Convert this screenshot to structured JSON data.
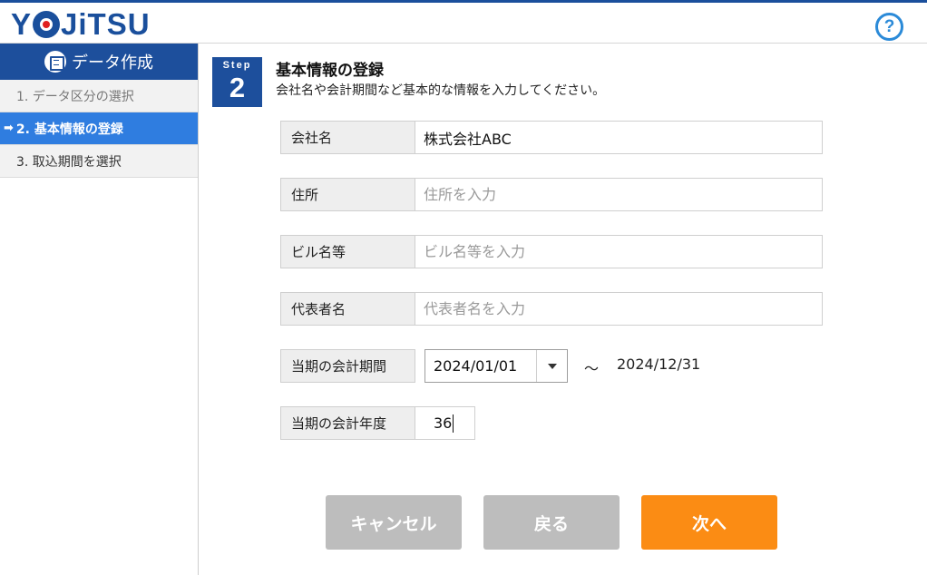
{
  "header": {
    "logo_text": "YOJiTSU",
    "help_label": "?"
  },
  "sidebar": {
    "title": "データ作成",
    "items": [
      {
        "label": "1. データ区分の選択",
        "state": "done"
      },
      {
        "label": "2. 基本情報の登録",
        "state": "active"
      },
      {
        "label": "3. 取込期間を選択",
        "state": "pending"
      }
    ]
  },
  "step": {
    "small_label": "Step",
    "number": "2",
    "title": "基本情報の登録",
    "subtitle": "会社名や会計期間など基本的な情報を入力してください。"
  },
  "form": {
    "company": {
      "label": "会社名",
      "value": "株式会社ABC",
      "placeholder": ""
    },
    "address": {
      "label": "住所",
      "value": "",
      "placeholder": "住所を入力"
    },
    "building": {
      "label": "ビル名等",
      "value": "",
      "placeholder": "ビル名等を入力"
    },
    "representative": {
      "label": "代表者名",
      "value": "",
      "placeholder": "代表者名を入力"
    },
    "period": {
      "label": "当期の会計期間",
      "start": "2024/01/01",
      "separator": "～",
      "end": "2024/12/31"
    },
    "fiscal_year": {
      "label": "当期の会計年度",
      "value": "36"
    }
  },
  "buttons": {
    "cancel": "キャンセル",
    "back": "戻る",
    "next": "次へ"
  },
  "colors": {
    "brand": "#1d4f9c",
    "active_step": "#2f7de0",
    "next_button": "#fb8c14",
    "disabled_button": "#bdbdbd"
  }
}
